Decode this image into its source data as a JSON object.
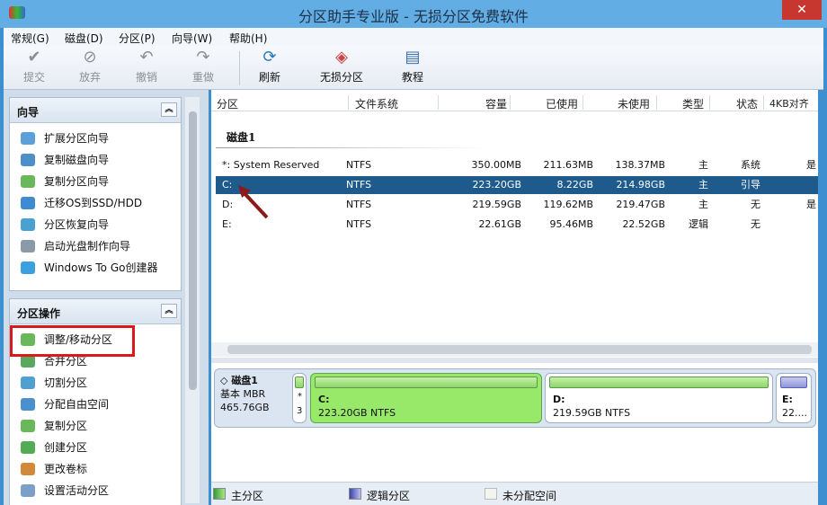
{
  "window": {
    "title": "分区助手专业版 - 无损分区免费软件",
    "close": "✕"
  },
  "menu": [
    "常规(G)",
    "磁盘(D)",
    "分区(P)",
    "向导(W)",
    "帮助(H)"
  ],
  "toolbar": [
    {
      "label": "提交",
      "icon": "✔"
    },
    {
      "label": "放弃",
      "icon": "⊘"
    },
    {
      "label": "撤销",
      "icon": "↶"
    },
    {
      "label": "重做",
      "icon": "↷"
    },
    {
      "label": "刷新",
      "icon": "⟳"
    },
    {
      "label": "无损分区",
      "icon": "◈"
    },
    {
      "label": "教程",
      "icon": "▤"
    }
  ],
  "wizard": {
    "title": "向导",
    "items": [
      "扩展分区向导",
      "复制磁盘向导",
      "复制分区向导",
      "迁移OS到SSD/HDD",
      "分区恢复向导",
      "启动光盘制作向导",
      "Windows To Go创建器"
    ]
  },
  "ops": {
    "title": "分区操作",
    "items": [
      "调整/移动分区",
      "合并分区",
      "切割分区",
      "分配自由空间",
      "复制分区",
      "创建分区",
      "更改卷标",
      "设置活动分区"
    ]
  },
  "table": {
    "columns": [
      "分区",
      "文件系统",
      "容量",
      "已使用",
      "未使用",
      "类型",
      "状态",
      "4KB对齐"
    ],
    "disk_label": "磁盘1",
    "rows": [
      [
        "*: System Reserved",
        "NTFS",
        "350.00MB",
        "211.63MB",
        "138.37MB",
        "主",
        "系统",
        "是"
      ],
      [
        "C:",
        "NTFS",
        "223.20GB",
        "8.22GB",
        "214.98GB",
        "主",
        "引导",
        ""
      ],
      [
        "D:",
        "NTFS",
        "219.59GB",
        "119.62MB",
        "219.47GB",
        "主",
        "无",
        "是"
      ],
      [
        "E:",
        "NTFS",
        "22.61GB",
        "95.46MB",
        "22.52GB",
        "逻辑",
        "无",
        ""
      ]
    ]
  },
  "diskmap": {
    "name": "磁盘1",
    "type": "基本 MBR",
    "size": "465.76GB",
    "sys_top": "*",
    "sys_bottom": "3",
    "c": {
      "name": "C:",
      "info": "223.20GB NTFS"
    },
    "d": {
      "name": "D:",
      "info": "219.59GB NTFS"
    },
    "e": {
      "name": "E:",
      "info": "22...."
    }
  },
  "legend": [
    "主分区",
    "逻辑分区",
    "未分配空间"
  ],
  "colors": {
    "primary": "#8fd66a",
    "logical": "#5560b8",
    "selected": "#1e5a8c"
  }
}
